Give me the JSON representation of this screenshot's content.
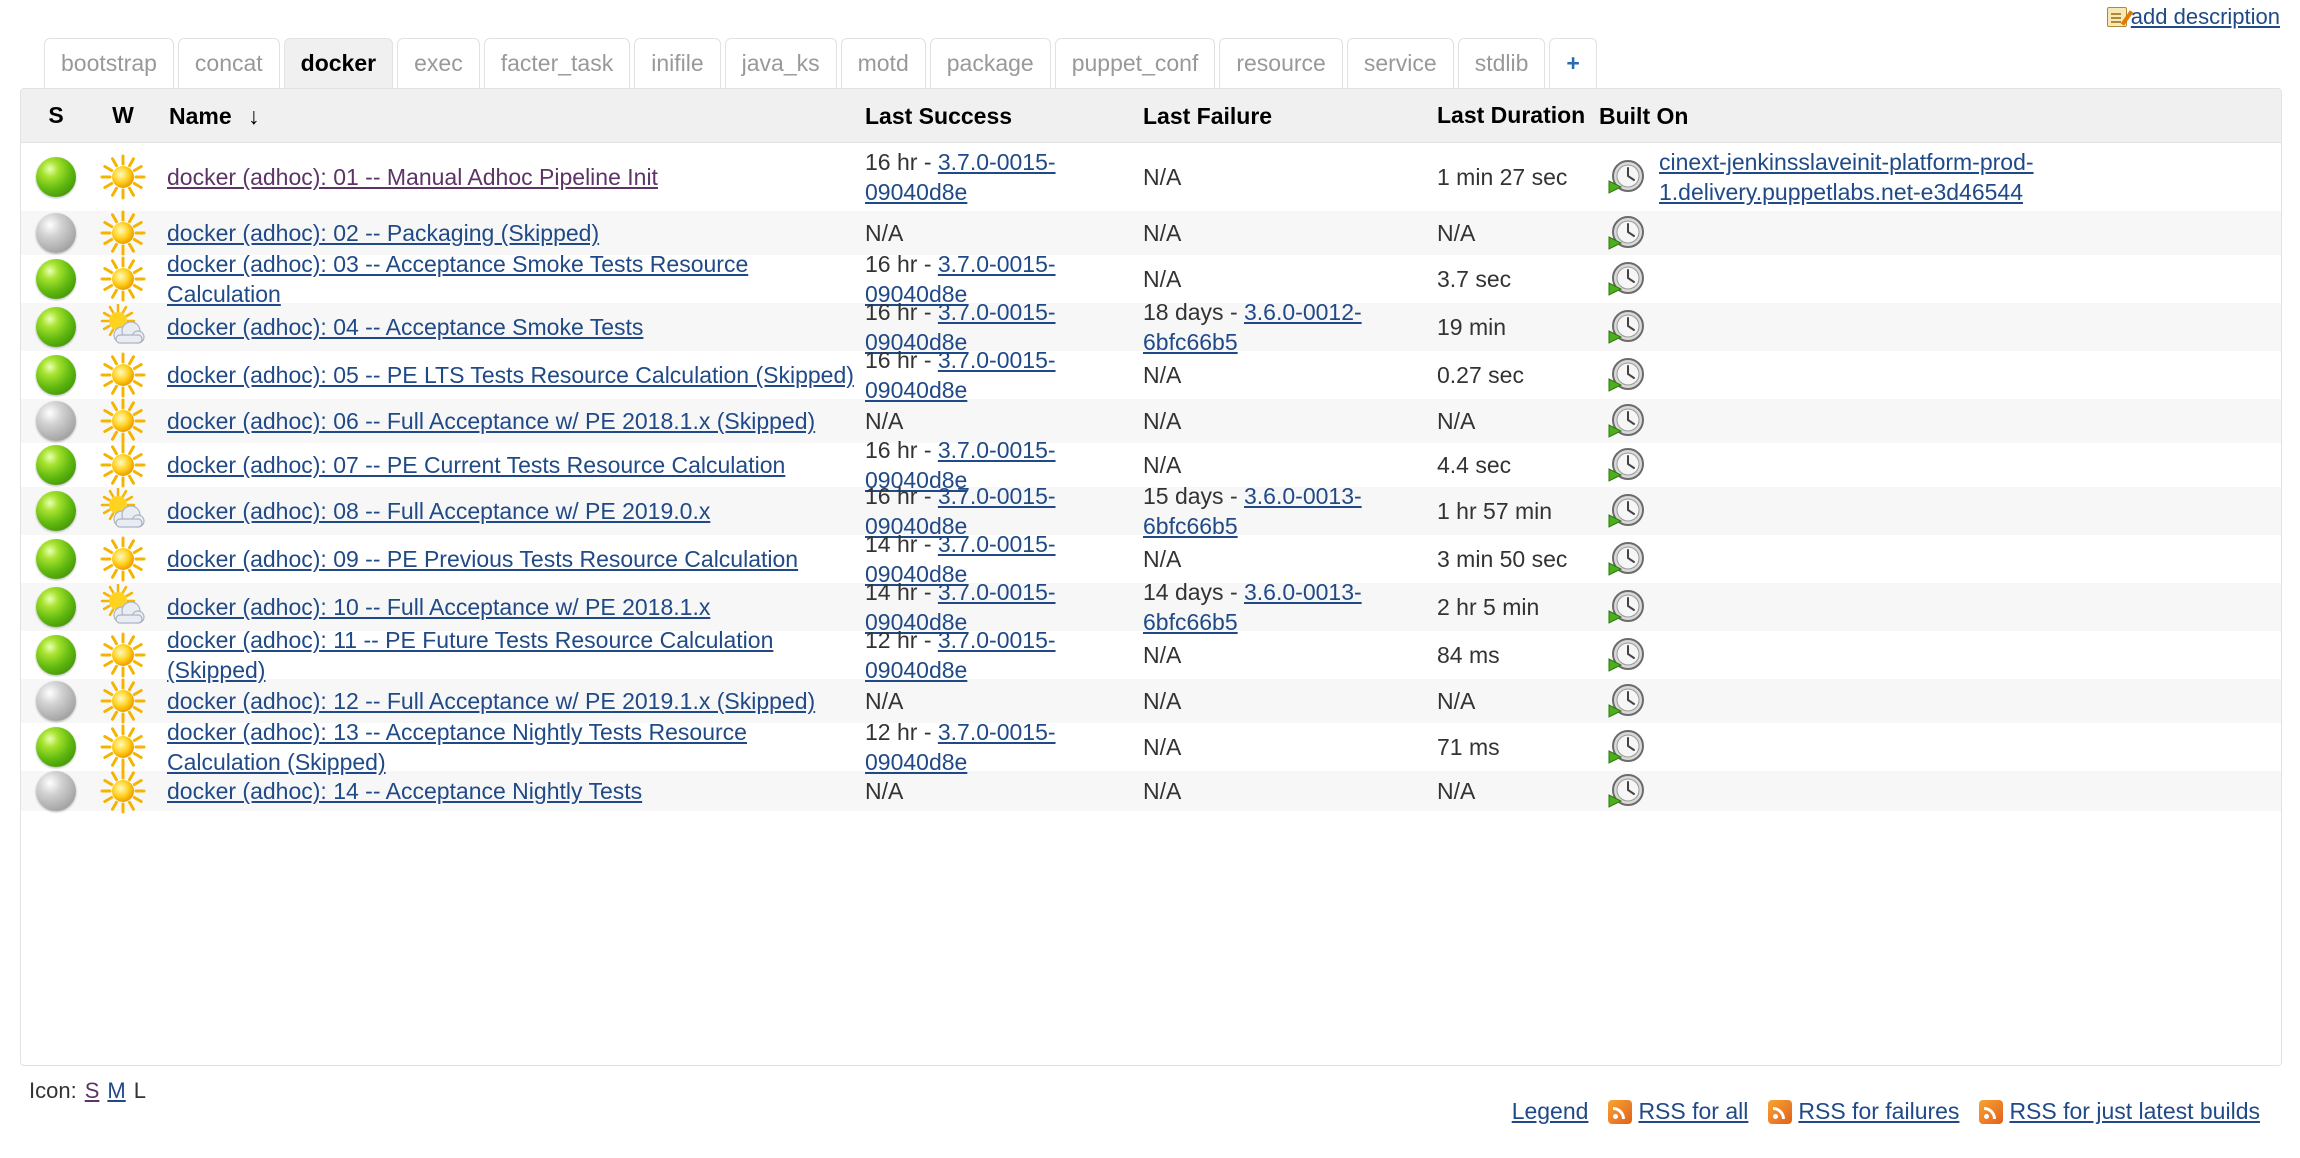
{
  "add_description_label": "add description",
  "tabs": [
    {
      "label": "bootstrap",
      "active": false
    },
    {
      "label": "concat",
      "active": false
    },
    {
      "label": "docker",
      "active": true
    },
    {
      "label": "exec",
      "active": false
    },
    {
      "label": "facter_task",
      "active": false
    },
    {
      "label": "inifile",
      "active": false
    },
    {
      "label": "java_ks",
      "active": false
    },
    {
      "label": "motd",
      "active": false
    },
    {
      "label": "package",
      "active": false
    },
    {
      "label": "puppet_conf",
      "active": false
    },
    {
      "label": "resource",
      "active": false
    },
    {
      "label": "service",
      "active": false
    },
    {
      "label": "stdlib",
      "active": false
    }
  ],
  "add_tab_label": "+",
  "columns": {
    "status": "S",
    "weather": "W",
    "name": "Name",
    "sort_arrow": "↓",
    "last_success": "Last Success",
    "last_failure": "Last Failure",
    "last_duration": "Last Duration",
    "built_on": "Built On"
  },
  "jobs": [
    {
      "status": "blue",
      "weather": "sunny",
      "name": "docker (adhoc): 01 -- Manual Adhoc Pipeline Init",
      "visited": true,
      "success_time": "16 hr - ",
      "success_build": "3.7.0-0015-09040d8e",
      "failure_time": "N/A",
      "failure_build": "",
      "duration": "1 min 27 sec",
      "built_on": "cinext-jenkinsslaveinit-platform-prod-1.delivery.puppetlabs.net-e3d46544"
    },
    {
      "status": "grey",
      "weather": "sunny",
      "name": "docker (adhoc): 02 -- Packaging (Skipped)",
      "visited": false,
      "success_time": "N/A",
      "success_build": "",
      "failure_time": "N/A",
      "failure_build": "",
      "duration": "N/A",
      "built_on": ""
    },
    {
      "status": "blue",
      "weather": "sunny",
      "name": "docker (adhoc): 03 -- Acceptance Smoke Tests Resource Calculation",
      "visited": false,
      "success_time": "16 hr - ",
      "success_build": "3.7.0-0015-09040d8e",
      "failure_time": "N/A",
      "failure_build": "",
      "duration": "3.7 sec",
      "built_on": ""
    },
    {
      "status": "blue",
      "weather": "partly-cloudy",
      "name": "docker (adhoc): 04 -- Acceptance Smoke Tests",
      "visited": false,
      "success_time": "16 hr - ",
      "success_build": "3.7.0-0015-09040d8e",
      "failure_time": "18 days - ",
      "failure_build": "3.6.0-0012-6bfc66b5",
      "duration": "19 min",
      "built_on": ""
    },
    {
      "status": "blue",
      "weather": "sunny",
      "name": "docker (adhoc): 05 -- PE LTS Tests Resource Calculation (Skipped)",
      "visited": false,
      "success_time": "16 hr - ",
      "success_build": "3.7.0-0015-09040d8e",
      "failure_time": "N/A",
      "failure_build": "",
      "duration": "0.27 sec",
      "built_on": ""
    },
    {
      "status": "grey",
      "weather": "sunny",
      "name": "docker (adhoc): 06 -- Full Acceptance w/ PE 2018.1.x (Skipped)",
      "visited": false,
      "success_time": "N/A",
      "success_build": "",
      "failure_time": "N/A",
      "failure_build": "",
      "duration": "N/A",
      "built_on": ""
    },
    {
      "status": "blue",
      "weather": "sunny",
      "name": "docker (adhoc): 07 -- PE Current Tests Resource Calculation",
      "visited": false,
      "success_time": "16 hr - ",
      "success_build": "3.7.0-0015-09040d8e",
      "failure_time": "N/A",
      "failure_build": "",
      "duration": "4.4 sec",
      "built_on": ""
    },
    {
      "status": "blue",
      "weather": "partly-cloudy",
      "name": "docker (adhoc): 08 -- Full Acceptance w/ PE 2019.0.x",
      "visited": false,
      "success_time": "16 hr - ",
      "success_build": "3.7.0-0015-09040d8e",
      "failure_time": "15 days - ",
      "failure_build": "3.6.0-0013-6bfc66b5",
      "duration": "1 hr 57 min",
      "built_on": ""
    },
    {
      "status": "blue",
      "weather": "sunny",
      "name": "docker (adhoc): 09 -- PE Previous Tests Resource Calculation",
      "visited": false,
      "success_time": "14 hr - ",
      "success_build": "3.7.0-0015-09040d8e",
      "failure_time": "N/A",
      "failure_build": "",
      "duration": "3 min 50 sec",
      "built_on": ""
    },
    {
      "status": "blue",
      "weather": "partly-cloudy",
      "name": "docker (adhoc): 10 -- Full Acceptance w/ PE 2018.1.x",
      "visited": false,
      "success_time": "14 hr - ",
      "success_build": "3.7.0-0015-09040d8e",
      "failure_time": "14 days - ",
      "failure_build": "3.6.0-0013-6bfc66b5",
      "duration": "2 hr 5 min",
      "built_on": ""
    },
    {
      "status": "blue",
      "weather": "sunny",
      "name": "docker (adhoc): 11 -- PE Future Tests Resource Calculation (Skipped)",
      "visited": false,
      "success_time": "12 hr - ",
      "success_build": "3.7.0-0015-09040d8e",
      "failure_time": "N/A",
      "failure_build": "",
      "duration": "84 ms",
      "built_on": ""
    },
    {
      "status": "grey",
      "weather": "sunny",
      "name": "docker (adhoc): 12 -- Full Acceptance w/ PE 2019.1.x (Skipped)",
      "visited": false,
      "success_time": "N/A",
      "success_build": "",
      "failure_time": "N/A",
      "failure_build": "",
      "duration": "N/A",
      "built_on": ""
    },
    {
      "status": "blue",
      "weather": "sunny",
      "name": "docker (adhoc): 13 -- Acceptance Nightly Tests Resource Calculation (Skipped)",
      "visited": false,
      "success_time": "12 hr - ",
      "success_build": "3.7.0-0015-09040d8e",
      "failure_time": "N/A",
      "failure_build": "",
      "duration": "71 ms",
      "built_on": ""
    },
    {
      "status": "grey",
      "weather": "sunny",
      "name": "docker (adhoc): 14 -- Acceptance Nightly Tests",
      "visited": false,
      "success_time": "N/A",
      "success_build": "",
      "failure_time": "N/A",
      "failure_build": "",
      "duration": "N/A",
      "built_on": ""
    }
  ],
  "icon_size": {
    "label": "Icon:",
    "options": [
      {
        "label": "S",
        "link": true,
        "visited": true
      },
      {
        "label": "M",
        "link": true,
        "visited": false
      },
      {
        "label": "L",
        "link": false,
        "visited": false
      }
    ]
  },
  "footer": {
    "legend": "Legend",
    "rss_all": "RSS for all",
    "rss_failures": "RSS for failures",
    "rss_latest": "RSS for just latest builds"
  },
  "colors": {
    "link": "#204a87",
    "visited": "#5c3566",
    "header_bg": "#f0f0f0",
    "alt_row_bg": "#f7f7f7"
  }
}
